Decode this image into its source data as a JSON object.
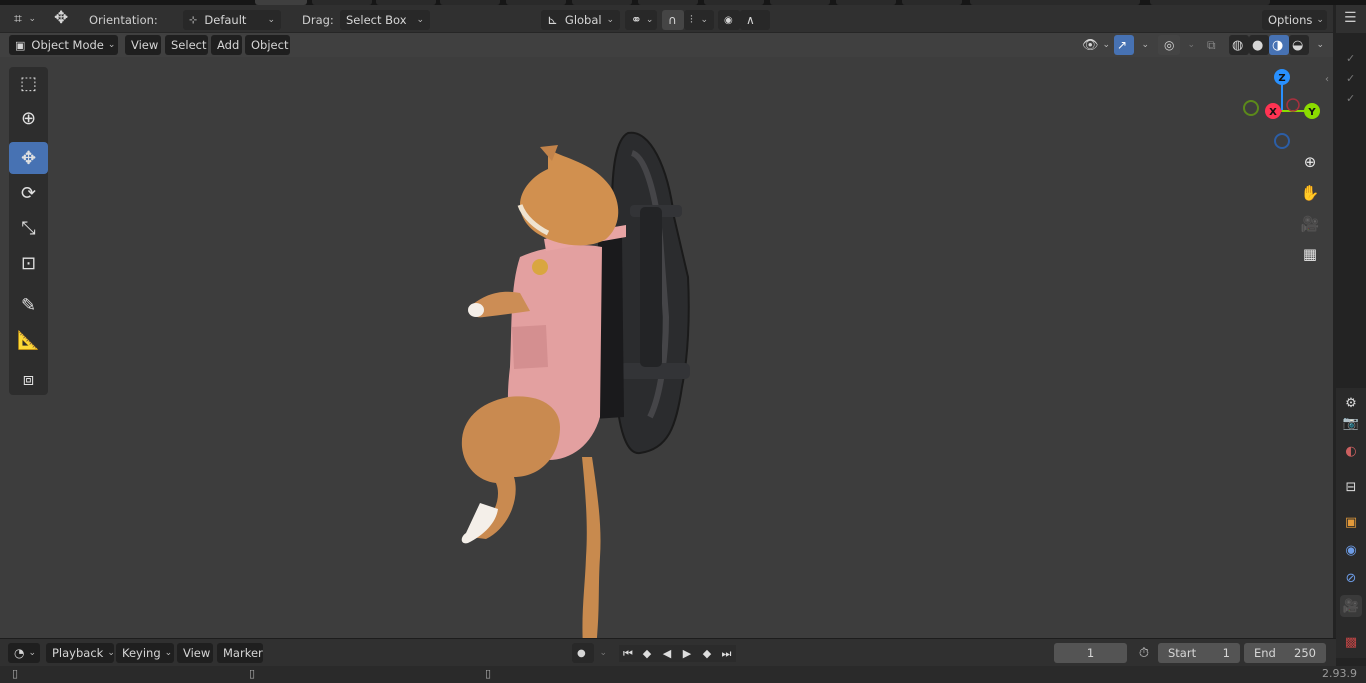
{
  "tool_header": {
    "orientation_label": "Orientation:",
    "orientation_value": "Default",
    "drag_label": "Drag:",
    "drag_value": "Select Box",
    "transform_orientation": "Global",
    "options_label": "Options"
  },
  "viewport_header": {
    "mode": "Object Mode",
    "menus": [
      "View",
      "Select",
      "Add",
      "Object"
    ]
  },
  "toolbar_tools": [
    "select-box",
    "cursor",
    "move",
    "rotate",
    "scale",
    "transform",
    "annotate",
    "measure",
    "add-cube"
  ],
  "active_tool": "move",
  "gizmo": {
    "x": "X",
    "y": "Y",
    "z": "Z"
  },
  "gizmo_colors": {
    "x": "#ff3352",
    "y": "#8bdc00",
    "z": "#2890ff"
  },
  "timeline": {
    "menus": [
      "Playback",
      "Keying",
      "View",
      "Marker"
    ],
    "current_frame": "1",
    "start_label": "Start",
    "start_value": "1",
    "end_label": "End",
    "end_value": "250"
  },
  "status": {
    "version": "2.93.9"
  },
  "accent_color": "#4772b3"
}
